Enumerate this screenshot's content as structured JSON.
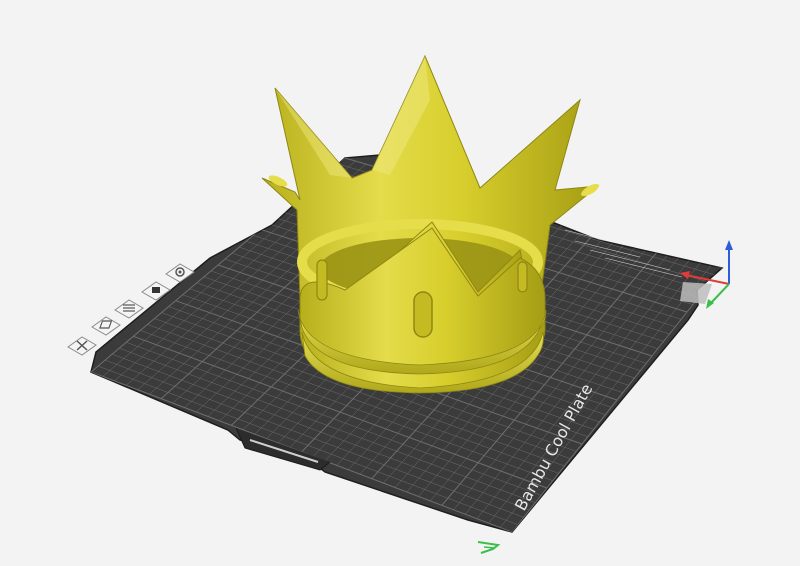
{
  "scene": {
    "background_color": "#f3f3f3",
    "plate": {
      "label": "Bambu Cool Plate",
      "surface_color": "#3b3b3b",
      "grid_color": "#6e6e6e",
      "edge_color": "#222222"
    },
    "model": {
      "name": "crown",
      "color": "#d8cf2f",
      "shade_color": "#a9a11a",
      "highlight_color": "#eee87a"
    },
    "plate_tools": [
      {
        "icon": "close-icon"
      },
      {
        "icon": "auto-orient-icon"
      },
      {
        "icon": "arrange-icon"
      },
      {
        "icon": "lock-icon"
      },
      {
        "icon": "settings-icon"
      }
    ],
    "axes": {
      "x_color": "#e03b3b",
      "y_color": "#3bbf4a",
      "z_color": "#2f5cd8"
    }
  }
}
